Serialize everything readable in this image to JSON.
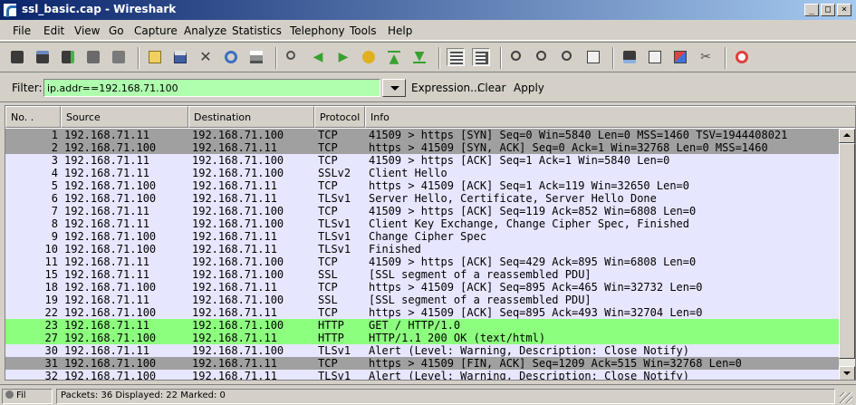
{
  "window": {
    "title": "ssl_basic.cap - Wireshark",
    "minimize": "_",
    "maximize": "□",
    "close": "×"
  },
  "menu": [
    "File",
    "Edit",
    "View",
    "Go",
    "Capture",
    "Analyze",
    "Statistics",
    "Telephony",
    "Tools",
    "Help"
  ],
  "toolbar_icons": [
    "interface-list-icon",
    "capture-options-icon",
    "start-capture-icon",
    "stop-capture-icon",
    "restart-capture-icon",
    "open-file-icon",
    "save-file-icon",
    "close-file-icon",
    "reload-icon",
    "print-icon",
    "find-packet-icon",
    "go-back-icon",
    "go-forward-icon",
    "go-to-packet-icon",
    "go-first-icon",
    "go-last-icon",
    "colorize-icon",
    "auto-scroll-icon",
    "zoom-in-icon",
    "zoom-out-icon",
    "normal-size-icon",
    "resize-columns-icon",
    "capture-filters-icon",
    "display-filters-icon",
    "coloring-rules-icon",
    "preferences-icon",
    "help-icon"
  ],
  "filter": {
    "label": "Filter:",
    "value": "ip.addr==192.168.71.100",
    "expression_label": "Expression...",
    "clear_label": "Clear",
    "apply_label": "Apply",
    "bg_color": "#afffaf"
  },
  "columns": [
    "No. .",
    "Source",
    "Destination",
    "Protocol",
    "Info"
  ],
  "colors": {
    "gray_row": "#a0a0a0",
    "lavender_row": "#e7e6ff",
    "http_row": "#8dff7f",
    "selected_row": "#2a2a8c"
  },
  "packets": [
    {
      "no": "1",
      "src": "192.168.71.11",
      "dst": "192.168.71.100",
      "proto": "TCP",
      "info": "41509 > https [SYN] Seq=0 Win=5840 Len=0 MSS=1460 TSV=1944408021",
      "bg": "#a0a0a0"
    },
    {
      "no": "2",
      "src": "192.168.71.100",
      "dst": "192.168.71.11",
      "proto": "TCP",
      "info": "https > 41509 [SYN, ACK] Seq=0 Ack=1 Win=32768 Len=0 MSS=1460",
      "bg": "#a0a0a0"
    },
    {
      "no": "3",
      "src": "192.168.71.11",
      "dst": "192.168.71.100",
      "proto": "TCP",
      "info": "41509 > https [ACK] Seq=1 Ack=1 Win=5840 Len=0",
      "bg": "#e7e6ff"
    },
    {
      "no": "4",
      "src": "192.168.71.11",
      "dst": "192.168.71.100",
      "proto": "SSLv2",
      "info": "Client Hello",
      "bg": "#e7e6ff"
    },
    {
      "no": "5",
      "src": "192.168.71.100",
      "dst": "192.168.71.11",
      "proto": "TCP",
      "info": "https > 41509 [ACK] Seq=1 Ack=119 Win=32650 Len=0",
      "bg": "#e7e6ff"
    },
    {
      "no": "6",
      "src": "192.168.71.100",
      "dst": "192.168.71.11",
      "proto": "TLSv1",
      "info": "Server Hello, Certificate, Server Hello Done",
      "bg": "#e7e6ff"
    },
    {
      "no": "7",
      "src": "192.168.71.11",
      "dst": "192.168.71.100",
      "proto": "TCP",
      "info": "41509 > https [ACK] Seq=119 Ack=852 Win=6808 Len=0",
      "bg": "#e7e6ff"
    },
    {
      "no": "8",
      "src": "192.168.71.11",
      "dst": "192.168.71.100",
      "proto": "TLSv1",
      "info": "Client Key Exchange, Change Cipher Spec, Finished",
      "bg": "#e7e6ff"
    },
    {
      "no": "9",
      "src": "192.168.71.100",
      "dst": "192.168.71.11",
      "proto": "TLSv1",
      "info": "Change Cipher Spec",
      "bg": "#e7e6ff"
    },
    {
      "no": "10",
      "src": "192.168.71.100",
      "dst": "192.168.71.11",
      "proto": "TLSv1",
      "info": "Finished",
      "bg": "#e7e6ff"
    },
    {
      "no": "11",
      "src": "192.168.71.11",
      "dst": "192.168.71.100",
      "proto": "TCP",
      "info": "41509 > https [ACK] Seq=429 Ack=895 Win=6808 Len=0",
      "bg": "#e7e6ff"
    },
    {
      "no": "15",
      "src": "192.168.71.11",
      "dst": "192.168.71.100",
      "proto": "SSL",
      "info": "[SSL segment of a reassembled PDU]",
      "bg": "#e7e6ff"
    },
    {
      "no": "18",
      "src": "192.168.71.100",
      "dst": "192.168.71.11",
      "proto": "TCP",
      "info": "https > 41509 [ACK] Seq=895 Ack=465 Win=32732 Len=0",
      "bg": "#e7e6ff"
    },
    {
      "no": "19",
      "src": "192.168.71.11",
      "dst": "192.168.71.100",
      "proto": "SSL",
      "info": "[SSL segment of a reassembled PDU]",
      "bg": "#e7e6ff"
    },
    {
      "no": "22",
      "src": "192.168.71.100",
      "dst": "192.168.71.11",
      "proto": "TCP",
      "info": "https > 41509 [ACK] Seq=895 Ack=493 Win=32704 Len=0",
      "bg": "#e7e6ff"
    },
    {
      "no": "23",
      "src": "192.168.71.11",
      "dst": "192.168.71.100",
      "proto": "HTTP",
      "info": "GET / HTTP/1.0",
      "bg": "#8dff7f"
    },
    {
      "no": "27",
      "src": "192.168.71.100",
      "dst": "192.168.71.11",
      "proto": "HTTP",
      "info": "HTTP/1.1 200 OK  (text/html)",
      "bg": "#8dff7f"
    },
    {
      "no": "30",
      "src": "192.168.71.11",
      "dst": "192.168.71.100",
      "proto": "TLSv1",
      "info": "Alert (Level: Warning, Description: Close Notify)",
      "bg": "#e7e6ff"
    },
    {
      "no": "31",
      "src": "192.168.71.100",
      "dst": "192.168.71.11",
      "proto": "TCP",
      "info": "https > 41509 [FIN, ACK] Seq=1209 Ack=515 Win=32768 Len=0",
      "bg": "#a0a0a0"
    },
    {
      "no": "32",
      "src": "192.168.71.100",
      "dst": "192.168.71.11",
      "proto": "TLSv1",
      "info": "Alert (Level: Warning, Description: Close Notify)",
      "bg": "#e7e6ff"
    }
  ],
  "status": {
    "expert": "Fil",
    "packets": "Packets: 36 Displayed: 22 Marked: 0"
  }
}
